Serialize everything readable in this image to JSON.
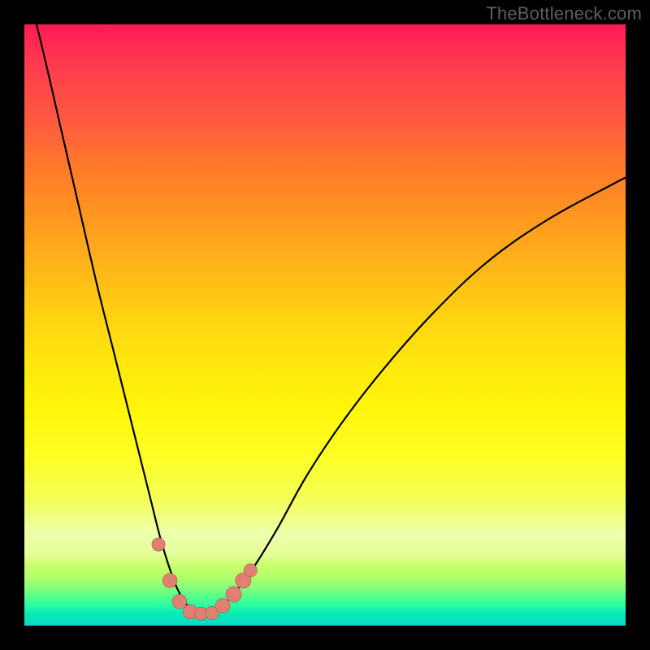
{
  "watermark": {
    "text": "TheBottleneck.com"
  },
  "colors": {
    "frame": "#000000",
    "curve": "#000000",
    "marker_fill": "#e08072",
    "marker_stroke": "#a85a4f"
  },
  "chart_data": {
    "type": "line",
    "title": "",
    "xlabel": "",
    "ylabel": "",
    "xlim": [
      0,
      100
    ],
    "ylim": [
      0,
      100
    ],
    "grid": false,
    "legend": null,
    "series": [
      {
        "name": "curve",
        "x": [
          0,
          3,
          6,
          9,
          12,
          15,
          18,
          21,
          22.5,
          24,
          25.5,
          27,
          28.5,
          30,
          31.5,
          33,
          35,
          38,
          42,
          47,
          53,
          60,
          68,
          77,
          87,
          98,
          100
        ],
        "y": [
          108,
          96,
          83,
          70,
          57,
          45,
          33,
          21,
          15,
          10,
          6,
          3.5,
          2.2,
          2,
          2.2,
          3.3,
          5.5,
          9.5,
          16,
          25,
          34,
          43,
          52,
          60.5,
          67.5,
          73.5,
          74.5
        ]
      }
    ],
    "markers": [
      {
        "x": 22.3,
        "y": 13.5,
        "r": 1.1
      },
      {
        "x": 24.2,
        "y": 7.5,
        "r": 1.2
      },
      {
        "x": 25.8,
        "y": 4.0,
        "r": 1.2
      },
      {
        "x": 27.6,
        "y": 2.3,
        "r": 1.2
      },
      {
        "x": 29.4,
        "y": 2.0,
        "r": 1.1
      },
      {
        "x": 31.2,
        "y": 2.1,
        "r": 1.1
      },
      {
        "x": 33.0,
        "y": 3.3,
        "r": 1.2
      },
      {
        "x": 34.8,
        "y": 5.2,
        "r": 1.3
      },
      {
        "x": 36.4,
        "y": 7.5,
        "r": 1.3
      },
      {
        "x": 37.6,
        "y": 9.2,
        "r": 1.1
      }
    ]
  }
}
